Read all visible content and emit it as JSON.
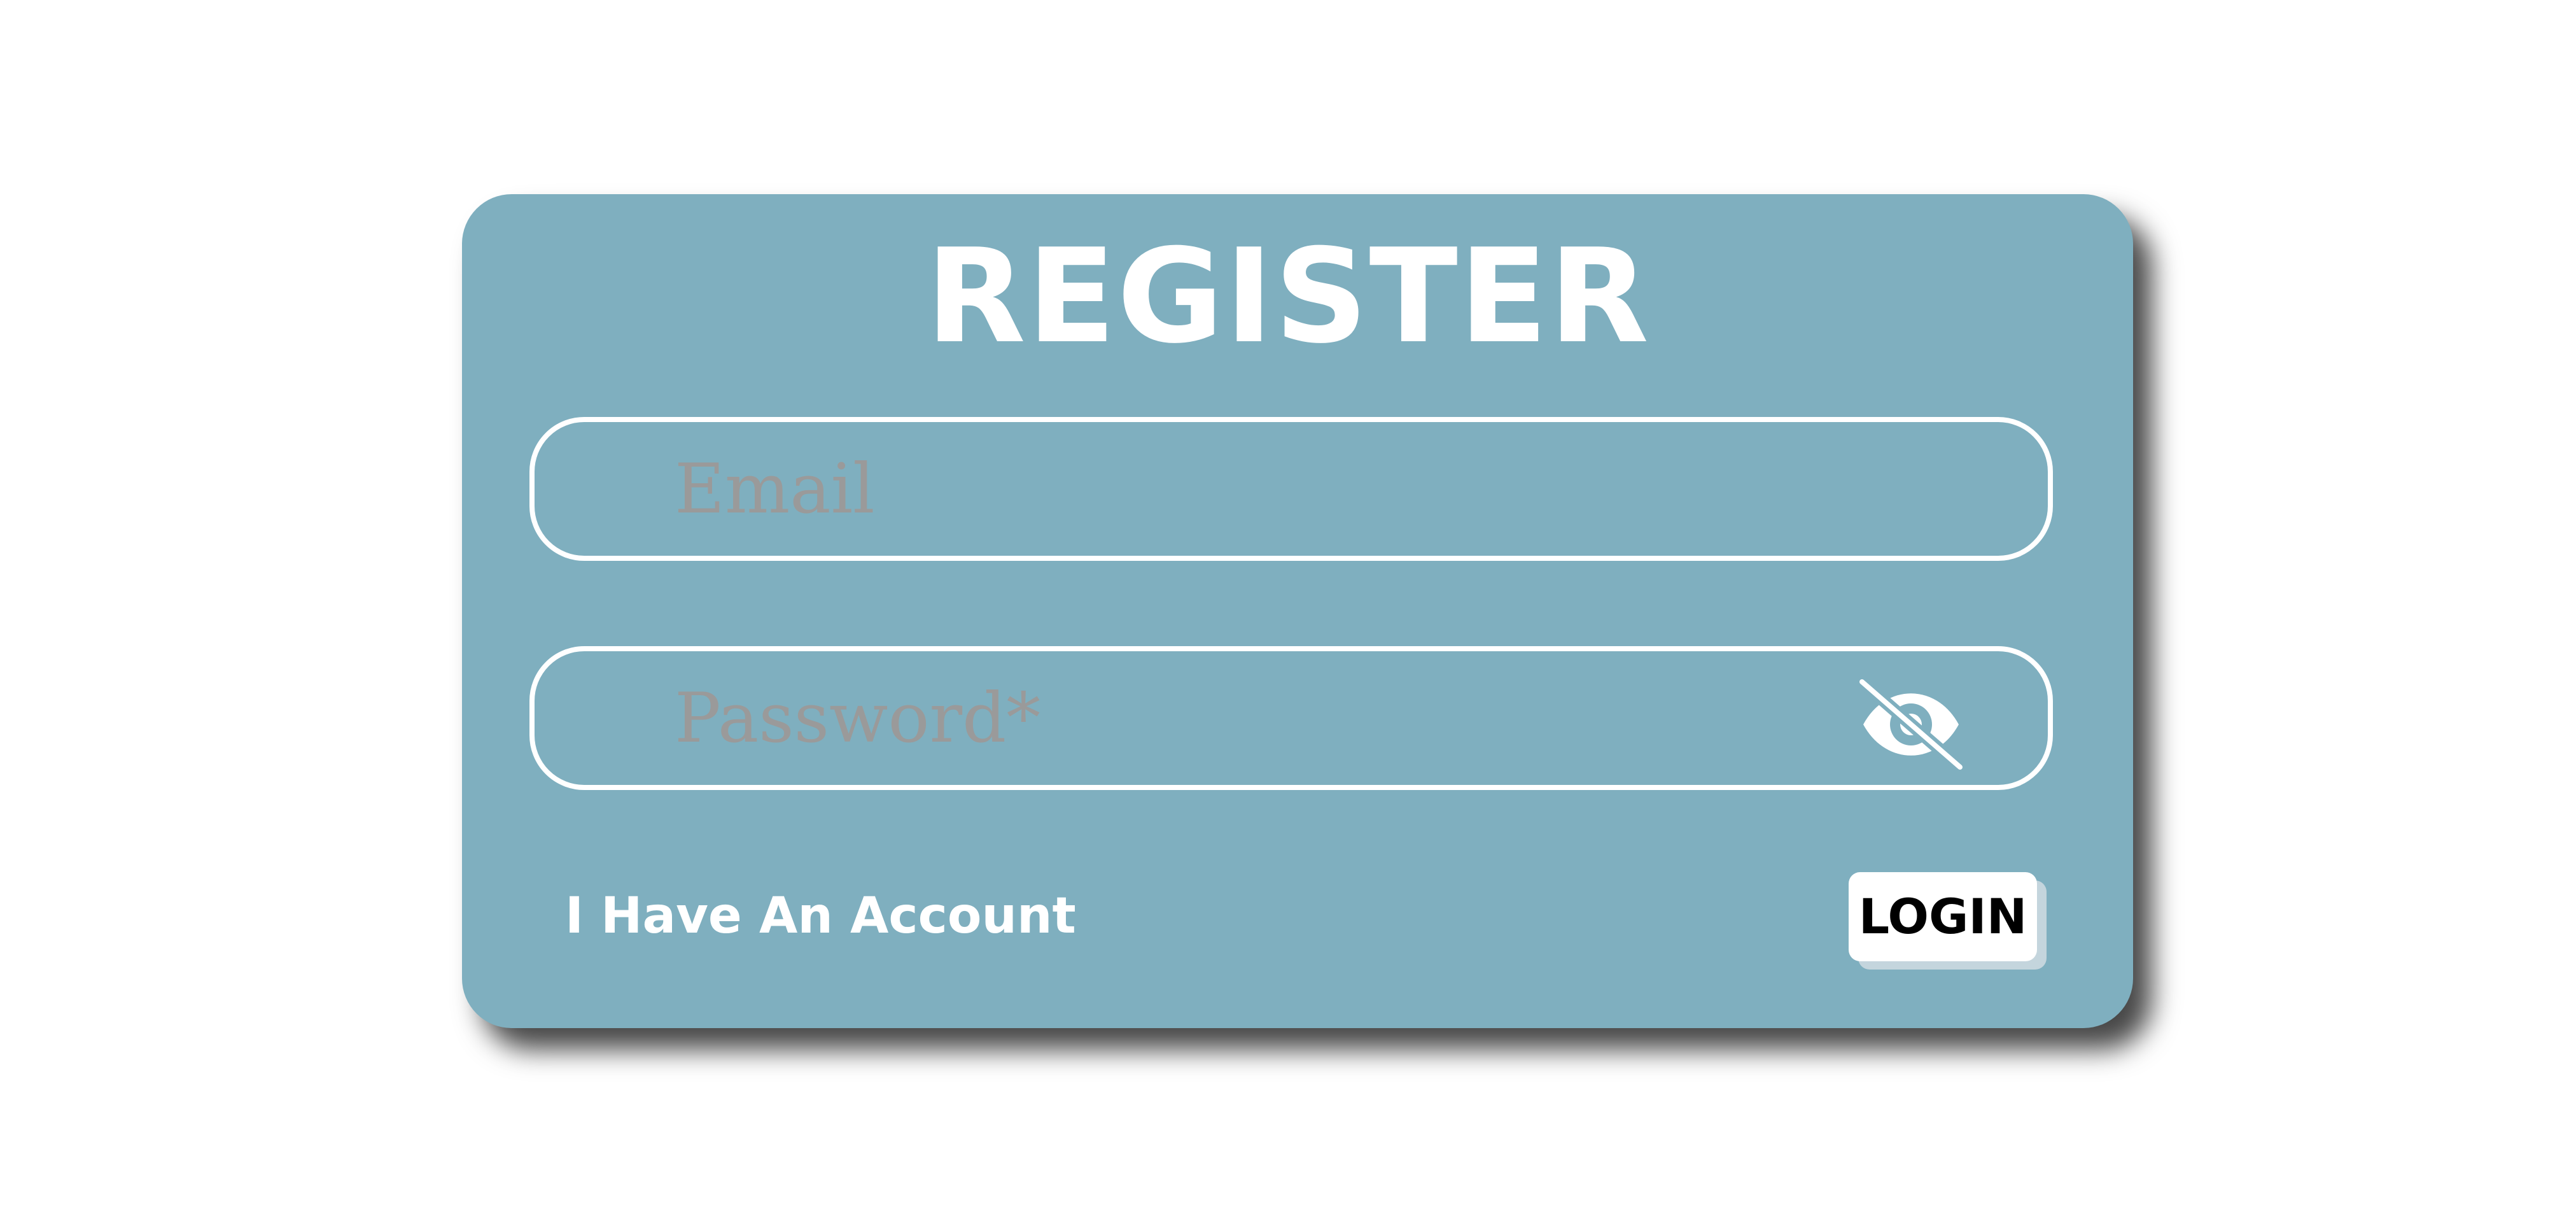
{
  "form": {
    "title": "REGISTER",
    "email": {
      "placeholder": "Email",
      "value": ""
    },
    "password": {
      "placeholder": "Password*",
      "value": "",
      "visibility_icon": "eye-slash-icon"
    },
    "account_link_label": "I Have An Account",
    "login_label": "LOGIN"
  },
  "colors": {
    "card_background": "#7fafbf",
    "text": "#ffffff",
    "placeholder": "#9a9a9a",
    "button_background": "#ffffff",
    "button_text": "#000000",
    "button_shadow": "#c4d5dd"
  }
}
